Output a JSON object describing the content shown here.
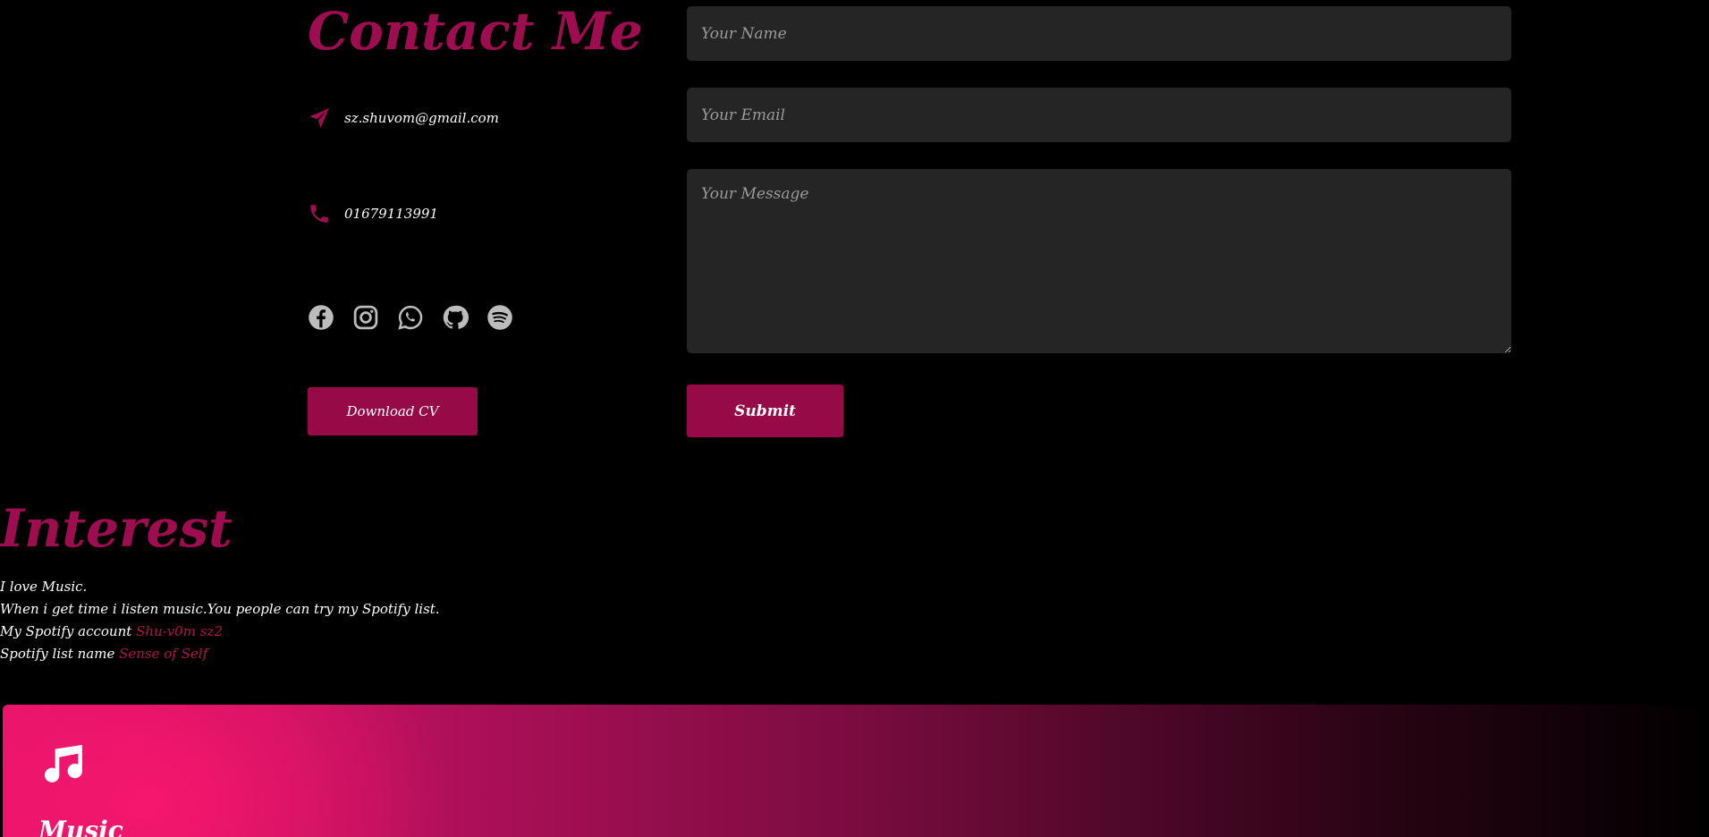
{
  "contact": {
    "title": "Contact Me",
    "email": "sz.shuvom@gmail.com",
    "phone": "01679113991",
    "socials": [
      "facebook-icon",
      "instagram-icon",
      "whatsapp-icon",
      "github-icon",
      "spotify-icon"
    ],
    "download_cv_label": "Download CV"
  },
  "form": {
    "name_placeholder": "Your Name",
    "email_placeholder": "Your Email",
    "message_placeholder": "Your Message",
    "submit_label": "Submit"
  },
  "interest": {
    "title": "Interest",
    "line1": "I love Music.",
    "line2": "When i get time i listen music.You people can try my Spotify list.",
    "account_label": "My Spotify account",
    "account_link": "Shu-v0m sz2",
    "list_label": "Spotify list name",
    "list_link": "Sense of Self"
  },
  "music_card": {
    "icon": "music-note-icon",
    "title": "Music"
  },
  "colors": {
    "accent": "#950a47",
    "heading": "#9e0d4f",
    "link": "#b0134f",
    "field_bg": "#252525",
    "background": "#000000"
  }
}
